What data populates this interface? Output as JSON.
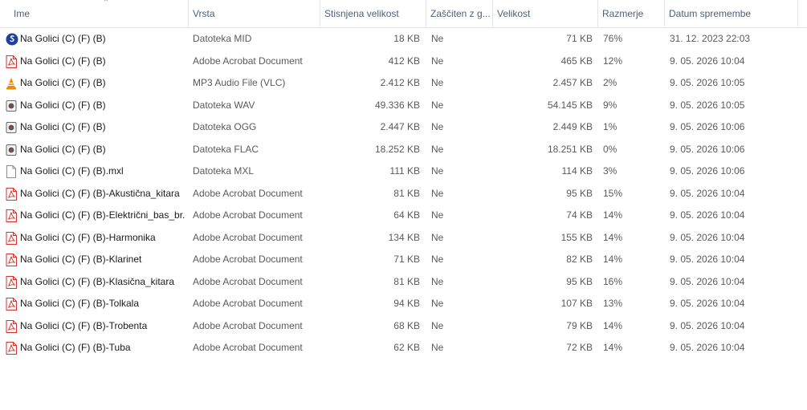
{
  "columns": {
    "name": "Ime",
    "type": "Vrsta",
    "compressed": "Stisnjena velikost",
    "protected": "Zaščiten z g...",
    "size": "Velikost",
    "ratio": "Razmerje",
    "modified": "Datum spremembe"
  },
  "files": [
    {
      "icon": "midi-icon",
      "name": "Na Golici (C) (F) (B)",
      "type": "Datoteka MID",
      "compressed": "18 KB",
      "protected": "Ne",
      "size": "71 KB",
      "ratio": "76%",
      "modified": "31. 12. 2023 22:03"
    },
    {
      "icon": "pdf-icon",
      "name": "Na Golici (C) (F) (B)",
      "type": "Adobe Acrobat Document",
      "compressed": "412 KB",
      "protected": "Ne",
      "size": "465 KB",
      "ratio": "12%",
      "modified": "9. 05. 2026 10:04"
    },
    {
      "icon": "vlc-icon",
      "name": "Na Golici (C) (F) (B)",
      "type": "MP3 Audio File (VLC)",
      "compressed": "2.412 KB",
      "protected": "Ne",
      "size": "2.457 KB",
      "ratio": "2%",
      "modified": "9. 05. 2026 10:05"
    },
    {
      "icon": "audio-icon",
      "name": "Na Golici (C) (F) (B)",
      "type": "Datoteka WAV",
      "compressed": "49.336 KB",
      "protected": "Ne",
      "size": "54.145 KB",
      "ratio": "9%",
      "modified": "9. 05. 2026 10:05"
    },
    {
      "icon": "audio-icon",
      "name": "Na Golici (C) (F) (B)",
      "type": "Datoteka OGG",
      "compressed": "2.447 KB",
      "protected": "Ne",
      "size": "2.449 KB",
      "ratio": "1%",
      "modified": "9. 05. 2026 10:06"
    },
    {
      "icon": "audio-icon",
      "name": "Na Golici (C) (F) (B)",
      "type": "Datoteka FLAC",
      "compressed": "18.252 KB",
      "protected": "Ne",
      "size": "18.251 KB",
      "ratio": "0%",
      "modified": "9. 05. 2026 10:06"
    },
    {
      "icon": "blank-file-icon",
      "name": "Na Golici (C) (F) (B).mxl",
      "type": "Datoteka MXL",
      "compressed": "111 KB",
      "protected": "Ne",
      "size": "114 KB",
      "ratio": "3%",
      "modified": "9. 05. 2026 10:06"
    },
    {
      "icon": "pdf-icon",
      "name": "Na Golici (C) (F) (B)-Akustična_kitara",
      "type": "Adobe Acrobat Document",
      "compressed": "81 KB",
      "protected": "Ne",
      "size": "95 KB",
      "ratio": "15%",
      "modified": "9. 05. 2026 10:04"
    },
    {
      "icon": "pdf-icon",
      "name": "Na Golici (C) (F) (B)-Električni_bas_br...",
      "type": "Adobe Acrobat Document",
      "compressed": "64 KB",
      "protected": "Ne",
      "size": "74 KB",
      "ratio": "14%",
      "modified": "9. 05. 2026 10:04"
    },
    {
      "icon": "pdf-icon",
      "name": "Na Golici (C) (F) (B)-Harmonika",
      "type": "Adobe Acrobat Document",
      "compressed": "134 KB",
      "protected": "Ne",
      "size": "155 KB",
      "ratio": "14%",
      "modified": "9. 05. 2026 10:04"
    },
    {
      "icon": "pdf-icon",
      "name": "Na Golici (C) (F) (B)-Klarinet",
      "type": "Adobe Acrobat Document",
      "compressed": "71 KB",
      "protected": "Ne",
      "size": "82 KB",
      "ratio": "14%",
      "modified": "9. 05. 2026 10:04"
    },
    {
      "icon": "pdf-icon",
      "name": "Na Golici (C) (F) (B)-Klasična_kitara",
      "type": "Adobe Acrobat Document",
      "compressed": "81 KB",
      "protected": "Ne",
      "size": "95 KB",
      "ratio": "16%",
      "modified": "9. 05. 2026 10:04"
    },
    {
      "icon": "pdf-icon",
      "name": "Na Golici (C) (F) (B)-Tolkala",
      "type": "Adobe Acrobat Document",
      "compressed": "94 KB",
      "protected": "Ne",
      "size": "107 KB",
      "ratio": "13%",
      "modified": "9. 05. 2026 10:04"
    },
    {
      "icon": "pdf-icon",
      "name": "Na Golici (C) (F) (B)-Trobenta",
      "type": "Adobe Acrobat Document",
      "compressed": "68 KB",
      "protected": "Ne",
      "size": "79 KB",
      "ratio": "14%",
      "modified": "9. 05. 2026 10:04"
    },
    {
      "icon": "pdf-icon",
      "name": "Na Golici (C) (F) (B)-Tuba",
      "type": "Adobe Acrobat Document",
      "compressed": "62 KB",
      "protected": "Ne",
      "size": "72 KB",
      "ratio": "14%",
      "modified": "9. 05. 2026 10:04"
    }
  ]
}
